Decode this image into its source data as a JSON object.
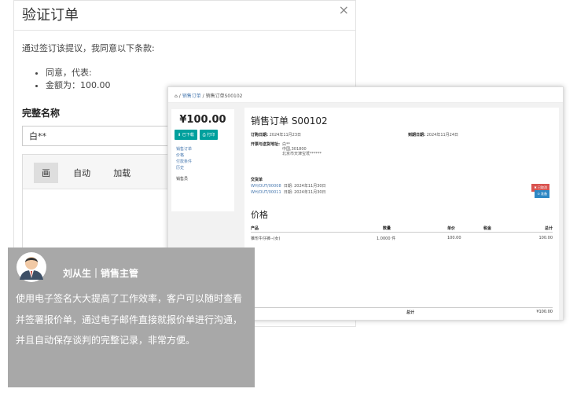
{
  "modal": {
    "title": "验证订单",
    "close_icon": "close-icon",
    "close": "×",
    "intro": "通过签订该提议，我同意以下条款:",
    "terms": [
      "同意，代表:",
      "金额为：100.00"
    ],
    "fullname_label": "完整名称",
    "fullname_value": "白**",
    "signature_tabs": [
      "画",
      "自动",
      "加载"
    ]
  },
  "order": {
    "breadcrumb": {
      "home_icon": "home-icon",
      "home": "⌂",
      "sep": "/",
      "items": [
        "销售订单",
        "销售订单S00102"
      ]
    },
    "price": "¥100.00",
    "buttons": [
      "⬇ 已下载",
      "⎙ 打印"
    ],
    "side_links": [
      "销售订单",
      "价格",
      "付款条件",
      "历史"
    ],
    "side_person": "销售员",
    "title": "销售订单 S00102",
    "order_date_label": "订购日期:",
    "order_date": "2024年11月23日",
    "due_date_label": "到期日期:",
    "due_date": "2024年11月24日",
    "address_label": "开票与送货地址:",
    "address": [
      "白**",
      "中国,301800",
      "北京市天津宝坻******"
    ],
    "delivery_label": "交货单",
    "deliveries": [
      {
        "ref": "WH/OUT/00008",
        "date_label": "日期:",
        "date": "2024年11月30日",
        "tag": "✖ 已取消"
      },
      {
        "ref": "WH/OUT/00011",
        "date_label": "日期:",
        "date": "2024年11月30日",
        "tag": "⊙ 准备"
      }
    ],
    "prices_title": "价格",
    "columns": [
      "产品",
      "数量",
      "单价",
      "税金",
      "总计"
    ],
    "line": {
      "product": "锥形牛仔裤--(女)",
      "qty": "1.0000 件",
      "unit": "100.00",
      "tax": "",
      "total": "100.00"
    },
    "total_label": "总计",
    "total_value": "¥100.00"
  },
  "testimonial": {
    "avatar_icon": "person-avatar-icon",
    "author": "刘从生｜销售主管",
    "quote": "使用电子签名大大提高了工作效率，客户可以随时查看并签署报价单，通过电子邮件直接就报价单进行沟通，并且自动保存谈判的完整记录，非常方便。"
  },
  "colors": {
    "accent": "#00a09d",
    "link": "#4a7ab0",
    "cancelled": "#d9534f",
    "ready": "#2d87c4",
    "testimonial_bg": "#a8a8a8"
  }
}
